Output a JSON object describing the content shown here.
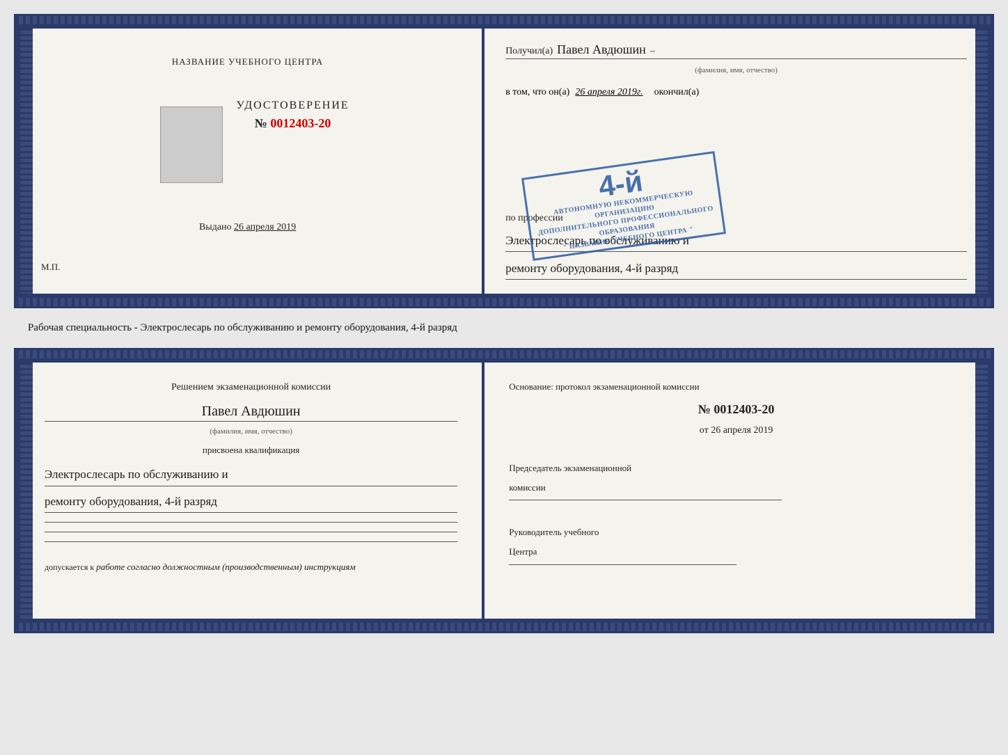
{
  "top_doc": {
    "left": {
      "institution_label": "НАЗВАНИЕ УЧЕБНОГО ЦЕНТРА",
      "cert_title": "УДОСТОВЕРЕНИЕ",
      "cert_number_prefix": "№",
      "cert_number": "0012403-20",
      "issued_label": "Выдано",
      "issued_date": "26 апреля 2019",
      "mp_label": "М.П."
    },
    "right": {
      "received_prefix": "Получил(а)",
      "recipient_name": "Павел Авдюшин",
      "name_sublabel": "(фамилия, имя, отчество)",
      "in_that_text": "в том, что он(а)",
      "completed_date": "26 апреля 2019г.",
      "completed_suffix": "окончил(а)",
      "stamp_grade": "4-й",
      "stamp_line1": "АВТОНОМНУЮ НЕКОММЕРЧЕСКУЮ ОРГАНИЗАЦИЮ",
      "stamp_line2": "ДОПОЛНИТЕЛЬНОГО ПРОФЕССИОНАЛЬНОГО ОБРАЗОВАНИЯ",
      "stamp_line3": "\" НАЗВАНИЕ УЧЕБНОГО ЦЕНТРА \"",
      "profession_label": "по профессии",
      "profession_line1": "Электрослесарь по обслуживанию и",
      "profession_line2": "ремонту оборудования, 4-й разряд"
    }
  },
  "middle_text": "Рабочая специальность - Электрослесарь по обслуживанию и ремонту оборудования, 4-й разряд",
  "bottom_doc": {
    "left": {
      "commission_line1": "Решением экзаменационной комиссии",
      "person_name": "Павел Авдюшин",
      "name_sublabel": "(фамилия, имя, отчество)",
      "assigned_label": "присвоена квалификация",
      "qualification_line1": "Электрослесарь по обслуживанию и",
      "qualification_line2": "ремонту оборудования, 4-й разряд",
      "allowed_prefix": "допускается к",
      "allowed_text": "работе согласно должностным (производственным) инструкциям"
    },
    "right": {
      "basis_label": "Основание: протокол экзаменационной комиссии",
      "protocol_prefix": "№",
      "protocol_number": "0012403-20",
      "date_prefix": "от",
      "protocol_date": "26 апреля 2019",
      "chairman_line1": "Председатель экзаменационной",
      "chairman_line2": "комиссии",
      "director_line1": "Руководитель учебного",
      "director_line2": "Центра"
    }
  }
}
